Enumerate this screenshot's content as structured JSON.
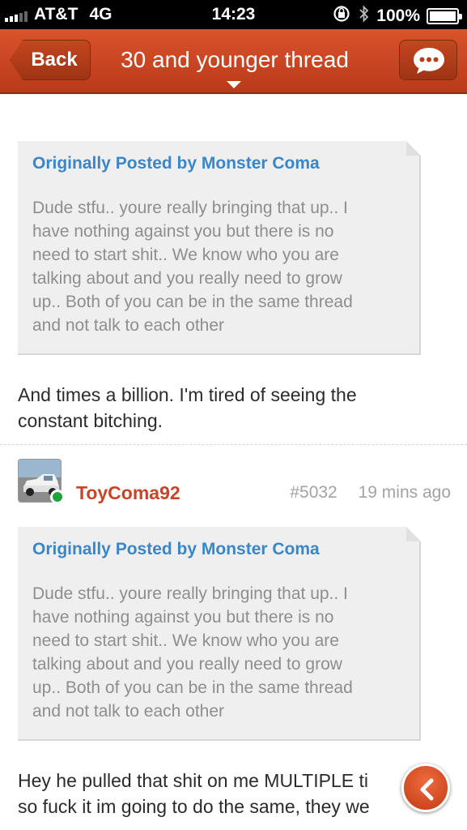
{
  "status_bar": {
    "carrier": "AT&T",
    "network": "4G",
    "time": "14:23",
    "battery": "100%",
    "icons": [
      "signal-icon",
      "rotation-lock-icon",
      "bluetooth-icon",
      "battery-icon"
    ]
  },
  "nav": {
    "back_label": "Back",
    "title": "30 and younger thread",
    "chat_icon": "chat-bubble-icon"
  },
  "posts": [
    {
      "quote": {
        "header": "Originally Posted by Monster Coma",
        "lines": [
          "Dude stfu.. youre really bringing that up.. I",
          "have nothing against you but there is no",
          "need to start shit.. We know  who you are",
          "talking about and you really need to grow",
          "up.. Both of you  can be in the same thread",
          "and not talk to each other"
        ]
      },
      "text_lines": [
        "And times a billion. I'm tired of seeing the",
        "constant bitching."
      ]
    },
    {
      "username": "ToyComa92",
      "post_number": "#5032",
      "time_ago": "19 mins ago",
      "online": true,
      "quote": {
        "header": "Originally Posted by Monster Coma",
        "lines": [
          "Dude stfu.. youre really bringing that up.. I",
          "have nothing against you but there is no",
          "need to start shit.. We know who you are",
          "talking about and you really need to grow",
          "up.. Both of you can be in the same thread",
          "and not talk to each other"
        ]
      },
      "text_lines": [
        "Hey he pulled that shit on me MULTIPLE ti",
        "so fuck it im going to do the same, they we"
      ]
    }
  ],
  "fab": {
    "icon": "chevron-left-icon"
  },
  "colors": {
    "nav_bar": "#c8452a",
    "quote_header": "#3b86c8",
    "username": "#c8452a",
    "online": "#1fa33a"
  }
}
